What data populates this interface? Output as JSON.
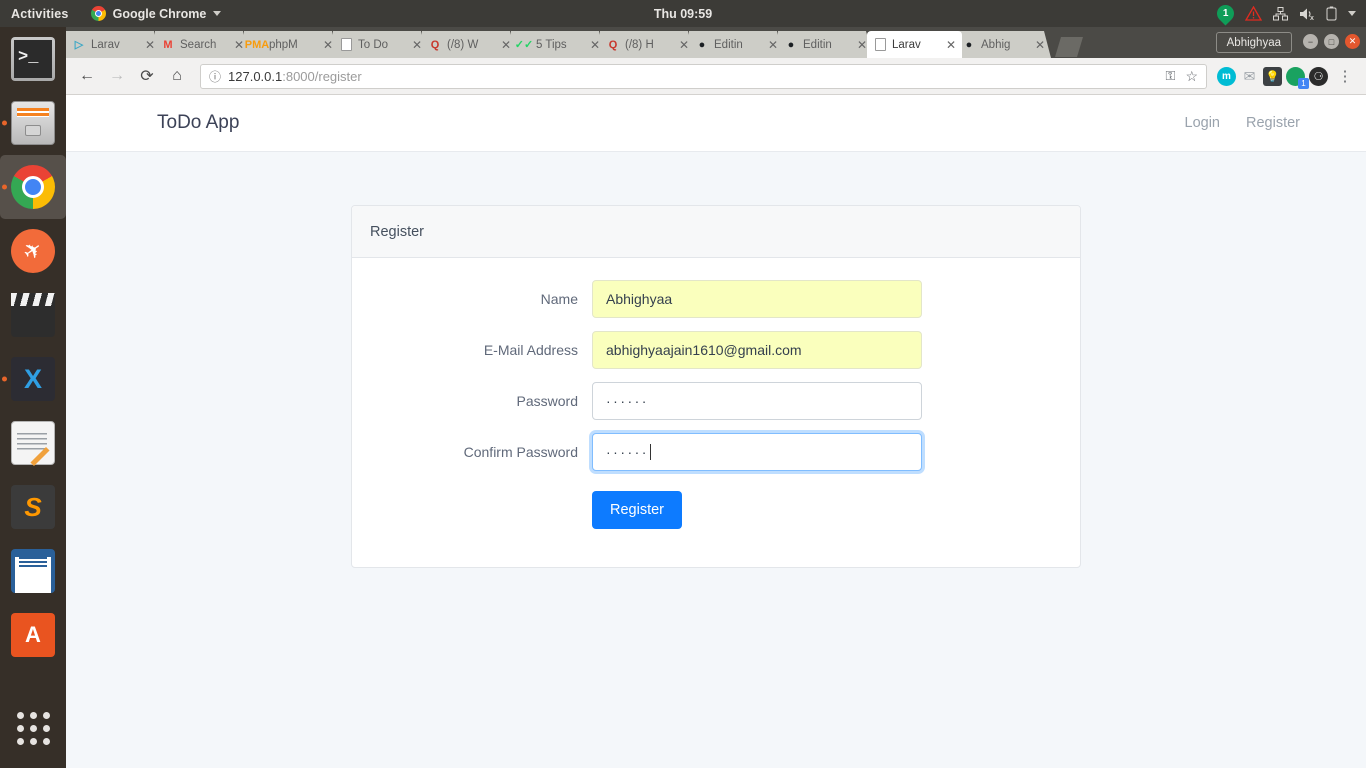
{
  "desktop": {
    "activities": "Activities",
    "app_menu": "Google Chrome",
    "clock": "Thu 09:59",
    "notification_count": "1",
    "indicators": [
      "notification-badge",
      "warning-triangle-icon",
      "network-icon",
      "volume-muted-icon",
      "battery-icon",
      "caret-down-icon"
    ]
  },
  "dock": {
    "items": [
      {
        "name": "terminal",
        "label": "Terminal",
        "glyph": ">_",
        "running": false,
        "active": false
      },
      {
        "name": "files",
        "label": "Files",
        "running": true,
        "active": false
      },
      {
        "name": "google-chrome",
        "label": "Google Chrome",
        "running": true,
        "active": true
      },
      {
        "name": "postman",
        "label": "Postman",
        "running": false,
        "active": false
      },
      {
        "name": "video-editor",
        "label": "Video Editor",
        "running": false,
        "active": false
      },
      {
        "name": "vs-code",
        "label": "Visual Studio Code",
        "running": true,
        "active": false
      },
      {
        "name": "text-editor",
        "label": "Text Editor",
        "running": false,
        "active": false
      },
      {
        "name": "sublime-text",
        "label": "Sublime Text",
        "running": false,
        "active": false
      },
      {
        "name": "libreoffice-writer",
        "label": "LibreOffice Writer",
        "running": false,
        "active": false
      },
      {
        "name": "ubuntu-software",
        "label": "Ubuntu Software",
        "running": false,
        "active": false
      },
      {
        "name": "show-applications",
        "label": "Show Applications",
        "running": false,
        "active": false
      }
    ]
  },
  "browser": {
    "profile_label": "Abhighyaa",
    "window_controls": {
      "minimize": "minimize-icon",
      "maximize": "maximize-icon",
      "close": "close-icon"
    },
    "tabs": [
      {
        "title": "Larav",
        "favicon": "laravel-icon",
        "active": false
      },
      {
        "title": "Search",
        "favicon": "gmail-icon",
        "active": false
      },
      {
        "title": "phpM",
        "favicon": "phpmyadmin-icon",
        "active": false
      },
      {
        "title": "To Do",
        "favicon": "document-icon",
        "active": false
      },
      {
        "title": "(/8) W",
        "favicon": "quora-icon",
        "active": false
      },
      {
        "title": "5 Tips",
        "favicon": "whatsapp-icon",
        "active": false
      },
      {
        "title": "(/8) H",
        "favicon": "quora-icon",
        "active": false
      },
      {
        "title": "Editin",
        "favicon": "github-icon",
        "active": false
      },
      {
        "title": "Editin",
        "favicon": "github-icon",
        "active": false
      },
      {
        "title": "Larav",
        "favicon": "document-icon",
        "active": true
      },
      {
        "title": "Abhig",
        "favicon": "github-icon",
        "active": false
      }
    ],
    "toolbar": {
      "back": "back-arrow-icon",
      "forward": "forward-arrow-icon",
      "reload": "reload-icon",
      "home": "home-icon",
      "url_host": "127.0.0.1",
      "url_path": ":8000/register",
      "security_icon": "info-circle-icon",
      "password_key_icon": "key-icon",
      "bookmark_icon": "star-icon",
      "menu_icon": "kebab-menu-icon",
      "extensions": [
        {
          "name": "extension-grammarly",
          "glyph": "m"
        },
        {
          "name": "extension-mail",
          "glyph": "✉"
        },
        {
          "name": "extension-keep",
          "glyph": "●"
        },
        {
          "name": "extension-green-badge",
          "glyph": "",
          "badge": "1"
        },
        {
          "name": "extension-dark",
          "glyph": "◑"
        }
      ]
    }
  },
  "app": {
    "brand": "ToDo App",
    "nav_links": [
      {
        "label": "Login"
      },
      {
        "label": "Register"
      }
    ],
    "card_title": "Register",
    "fields": [
      {
        "label": "Name",
        "value": "Abhighyaa",
        "type": "text",
        "autofill": true,
        "focused": false
      },
      {
        "label": "E-Mail Address",
        "value": "abhighyaajain1610@gmail.com",
        "type": "email",
        "autofill": true,
        "focused": false
      },
      {
        "label": "Password",
        "value": "······",
        "type": "password",
        "autofill": false,
        "focused": false
      },
      {
        "label": "Confirm Password",
        "value": "······",
        "type": "password",
        "autofill": false,
        "focused": true
      }
    ],
    "submit_label": "Register"
  },
  "colors": {
    "accent": "#0d7bff",
    "autofill": "#faffbd",
    "page_bg": "#f4f7fa",
    "focus_ring": "#80bdff"
  }
}
